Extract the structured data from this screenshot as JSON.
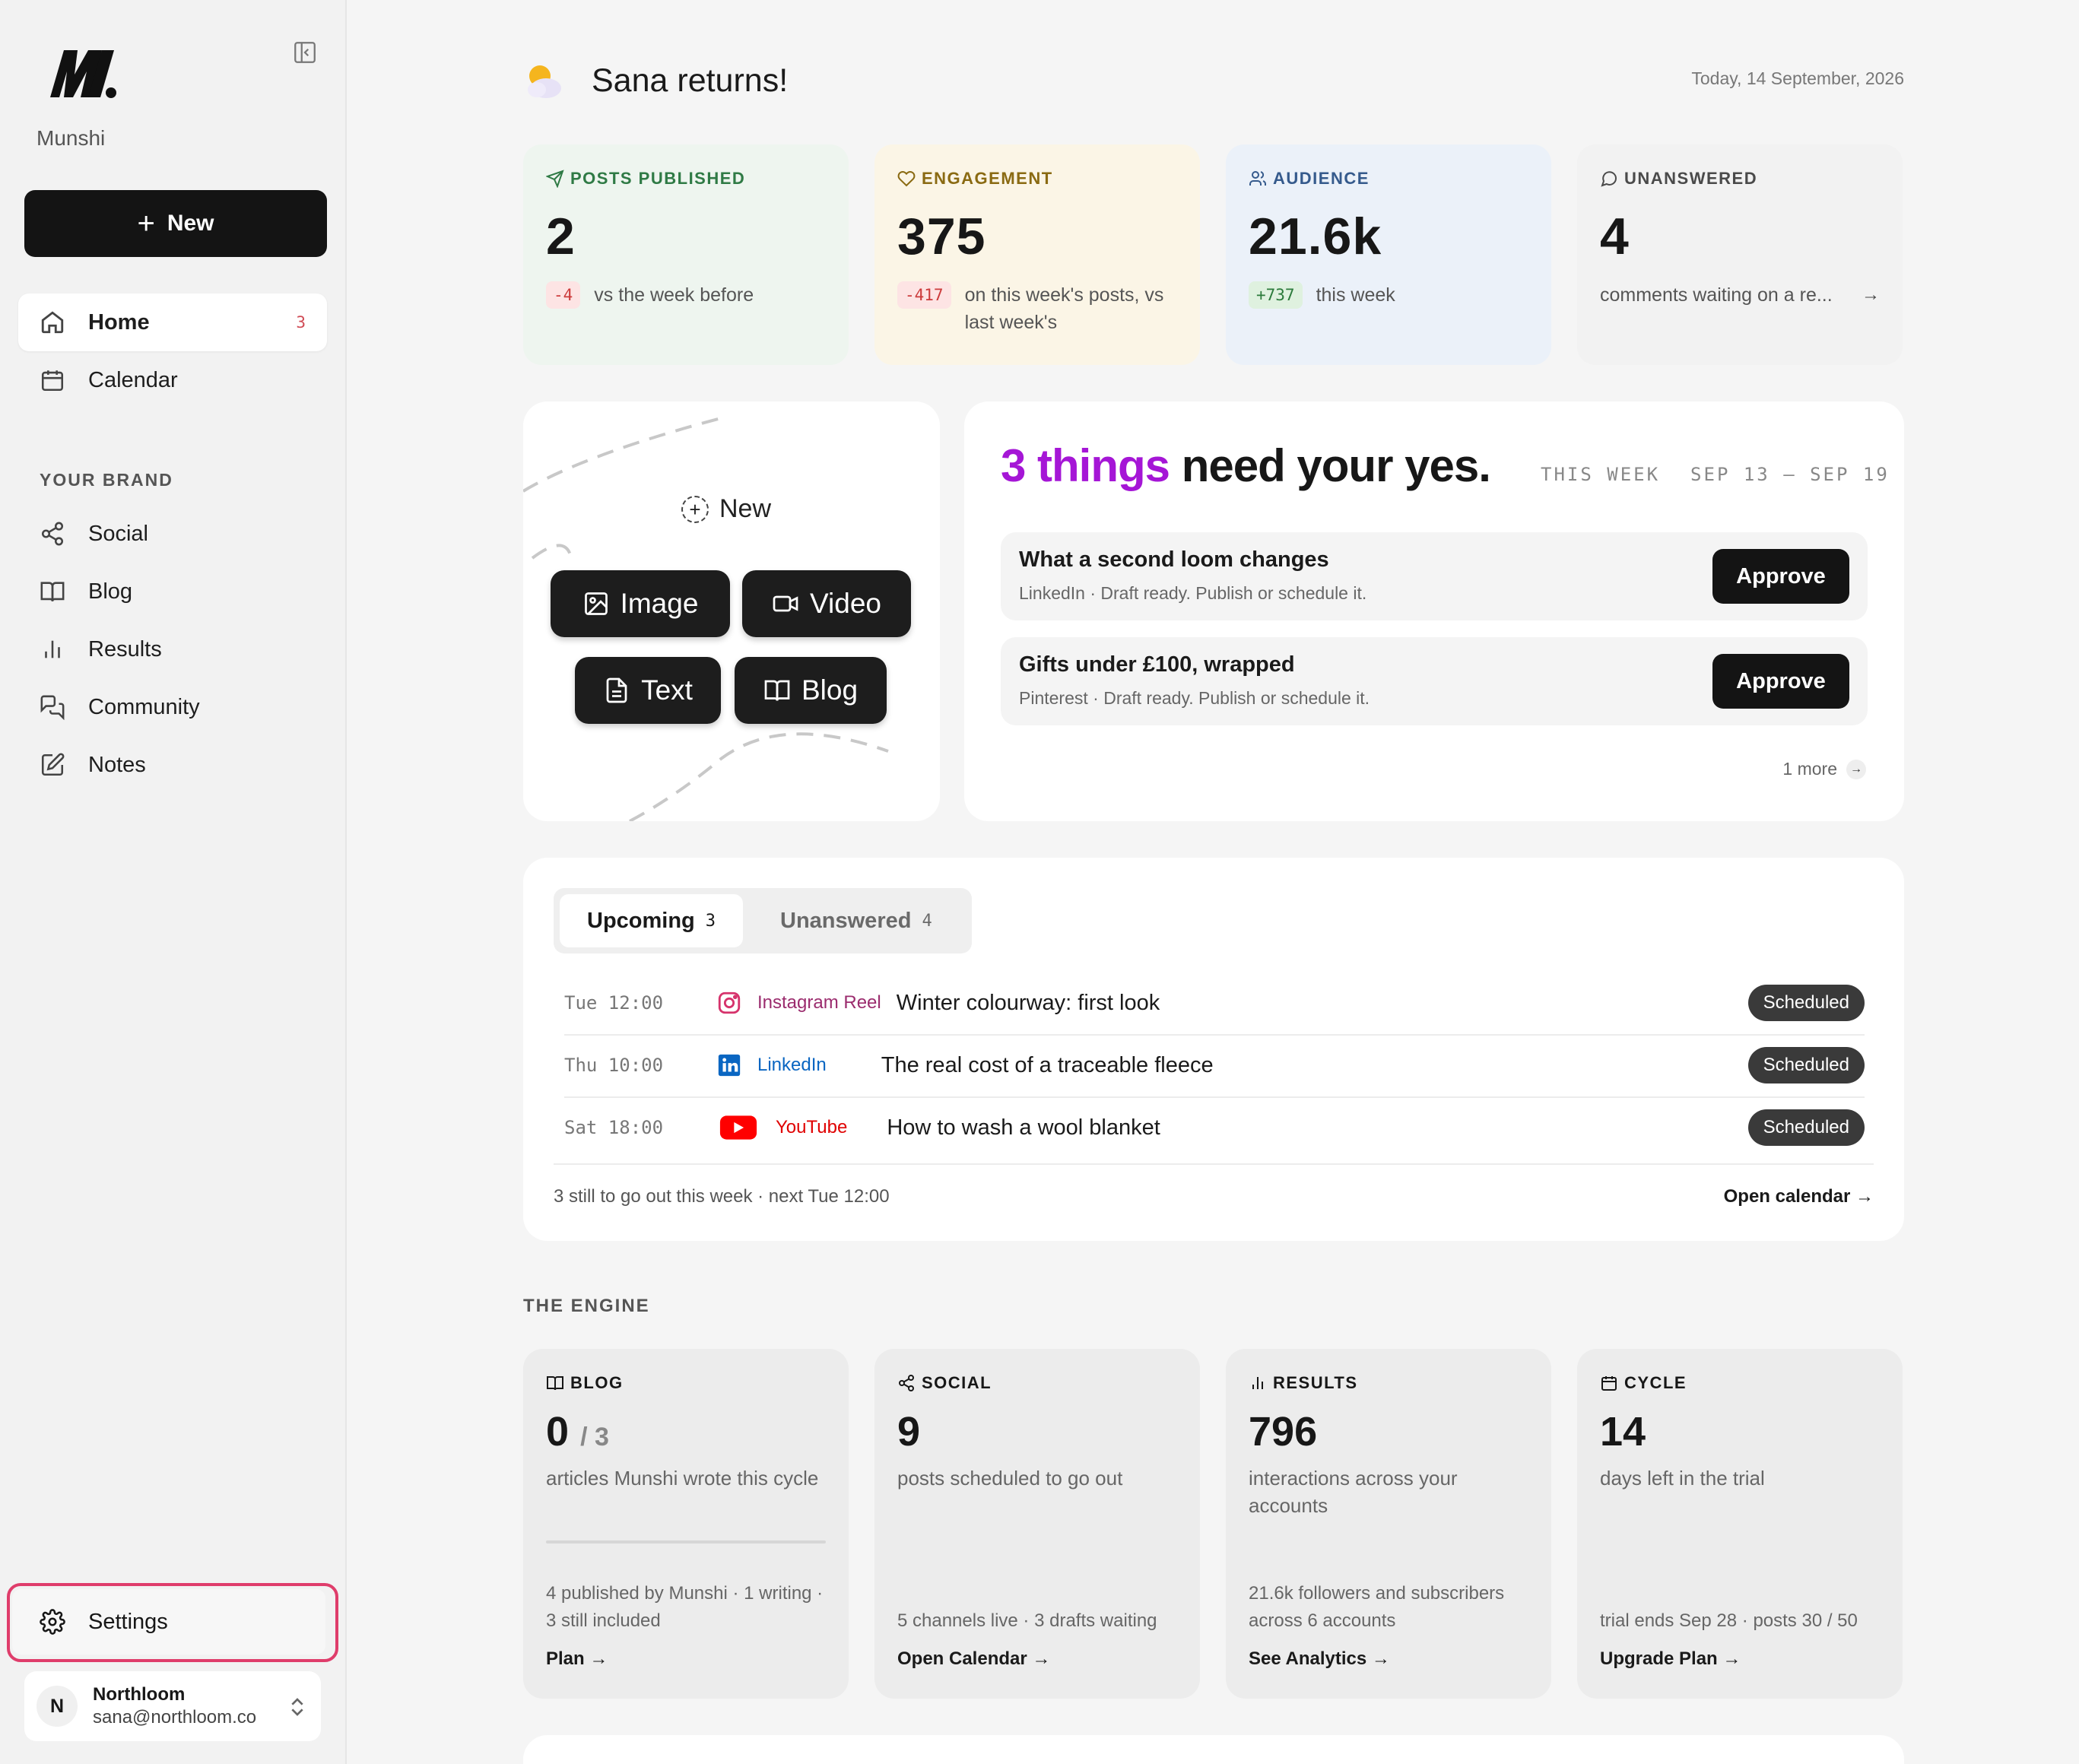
{
  "sidebar": {
    "brand": "Munshi",
    "new_label": "New",
    "nav": [
      {
        "label": "Home",
        "count": "3"
      },
      {
        "label": "Calendar"
      }
    ],
    "section": "YOUR BRAND",
    "brand_nav": [
      {
        "label": "Social"
      },
      {
        "label": "Blog"
      },
      {
        "label": "Results"
      },
      {
        "label": "Community"
      },
      {
        "label": "Notes"
      }
    ],
    "settings": "Settings",
    "account": {
      "initial": "N",
      "name": "Northloom",
      "email": "sana@northloom.co"
    }
  },
  "header": {
    "greeting": "Sana returns!",
    "date": "Today, 14 September, 2026"
  },
  "stats": [
    {
      "label": "POSTS PUBLISHED",
      "value": "2",
      "delta": "-4",
      "note": "vs the week before",
      "color": "#2f7a45",
      "bg": "#eef5ef"
    },
    {
      "label": "ENGAGEMENT",
      "value": "375",
      "delta": "-417",
      "note": "on this week's posts, vs last week's",
      "color": "#8a6a12",
      "bg": "#fbf5e6"
    },
    {
      "label": "AUDIENCE",
      "value": "21.6k",
      "delta": "+737",
      "note": "this week",
      "color": "#355a8c",
      "bg": "#ebf1f9"
    },
    {
      "label": "UNANSWERED",
      "value": "4",
      "note": "comments waiting on a re...",
      "color": "#4a4a4a",
      "bg": "#f2f2f2"
    }
  ],
  "create": {
    "new_label": "New",
    "buttons": {
      "image": "Image",
      "video": "Video",
      "text": "Text",
      "blog": "Blog"
    }
  },
  "approvals": {
    "headline_highlight": "3 things",
    "headline_rest": "need your yes.",
    "week_label": "THIS WEEK",
    "week_range": "SEP 13 – SEP 19",
    "items": [
      {
        "title": "What a second loom changes",
        "meta": "LinkedIn · Draft ready. Publish or schedule it.",
        "action": "Approve"
      },
      {
        "title": "Gifts under £100, wrapped",
        "meta": "Pinterest · Draft ready. Publish or schedule it.",
        "action": "Approve"
      }
    ],
    "more": "1 more"
  },
  "upcoming": {
    "tabs": [
      {
        "label": "Upcoming",
        "count": "3"
      },
      {
        "label": "Unanswered",
        "count": "4"
      }
    ],
    "rows": [
      {
        "time": "Tue 12:00",
        "channel": "Instagram Reel",
        "title": "Winter colourway: first look",
        "status": "Scheduled",
        "channel_color": "#9b2c6e"
      },
      {
        "time": "Thu 10:00",
        "channel": "LinkedIn",
        "title": "The real cost of a traceable fleece",
        "status": "Scheduled",
        "channel_color": "#0a66c2"
      },
      {
        "time": "Sat 18:00",
        "channel": "YouTube",
        "title": "How to wash a wool blanket",
        "status": "Scheduled",
        "channel_color": "#e00000"
      }
    ],
    "footer": "3 still to go out this week · next Tue 12:00",
    "link": "Open calendar →"
  },
  "engine": {
    "label": "THE ENGINE",
    "cards": [
      {
        "label": "BLOG",
        "value": "0",
        "total": "/ 3",
        "desc": "articles Munshi wrote this cycle",
        "foot": "4 published by Munshi · 1 writing · 3 still included",
        "action": "Plan →",
        "progress": 0
      },
      {
        "label": "SOCIAL",
        "value": "9",
        "desc": "posts scheduled to go out",
        "foot": "5 channels live · 3 drafts waiting",
        "action": "Open Calendar →"
      },
      {
        "label": "RESULTS",
        "value": "796",
        "desc": "interactions across your accounts",
        "foot": "21.6k followers and subscribers across 6 accounts",
        "action": "See Analytics →"
      },
      {
        "label": "CYCLE",
        "value": "14",
        "desc": "days left in the trial",
        "foot": "trial ends Sep 28 · posts 30 / 50",
        "action": "Upgrade Plan →"
      }
    ]
  }
}
